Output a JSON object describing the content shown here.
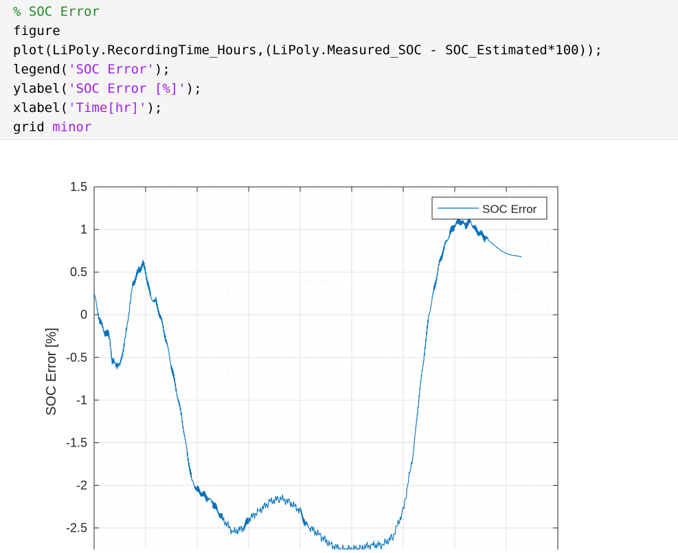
{
  "code": {
    "lines": [
      [
        {
          "t": "% SOC Error",
          "c": "comment"
        }
      ],
      [
        {
          "t": "figure",
          "c": "plain"
        }
      ],
      [
        {
          "t": "plot(LiPoly.RecordingTime_Hours,(LiPoly.Measured_SOC - SOC_Estimated*100));",
          "c": "plain"
        }
      ],
      [
        {
          "t": "legend(",
          "c": "plain"
        },
        {
          "t": "'SOC Error'",
          "c": "str"
        },
        {
          "t": ");",
          "c": "plain"
        }
      ],
      [
        {
          "t": "ylabel(",
          "c": "plain"
        },
        {
          "t": "'SOC Error [%]'",
          "c": "str"
        },
        {
          "t": ");",
          "c": "plain"
        }
      ],
      [
        {
          "t": "xlabel(",
          "c": "plain"
        },
        {
          "t": "'Time[hr]'",
          "c": "str"
        },
        {
          "t": ");",
          "c": "plain"
        }
      ],
      [
        {
          "t": "grid ",
          "c": "plain"
        },
        {
          "t": "minor",
          "c": "str"
        }
      ]
    ]
  },
  "colors": {
    "line": "#0072bd",
    "comment": "#228b22",
    "string": "#a020f0",
    "code_bg": "#f5f5f5",
    "major_grid": "#dcdcdc",
    "minor_grid": "#ececec"
  },
  "chart_data": {
    "type": "line",
    "title": "",
    "xlabel": "",
    "ylabel": "SOC Error [%]",
    "xlim": [
      0,
      9
    ],
    "ylim": [
      -2.85,
      1.5
    ],
    "y_ticks": [
      1.5,
      1,
      0.5,
      0,
      -0.5,
      -1,
      -1.5,
      -2,
      -2.5
    ],
    "y_tick_labels": [
      "1.5",
      "1",
      "0.5",
      "0",
      "-0.5",
      "-1",
      "-1.5",
      "-2",
      "-2.5"
    ],
    "x_ticks": [
      0,
      1,
      2,
      3,
      4,
      5,
      6,
      7,
      8,
      9
    ],
    "grid": "minor",
    "legend": {
      "entries": [
        "SOC Error"
      ],
      "location": "top-right"
    },
    "series": [
      {
        "name": "SOC Error",
        "x": [
          0.0,
          0.1,
          0.2,
          0.3,
          0.35,
          0.5,
          0.6,
          0.75,
          0.85,
          0.9,
          0.95,
          1.0,
          1.1,
          1.2,
          1.3,
          1.4,
          1.5,
          1.6,
          1.7,
          1.8,
          1.9,
          2.0,
          2.1,
          2.2,
          2.3,
          2.4,
          2.5,
          2.7,
          2.9,
          3.0,
          3.2,
          3.4,
          3.6,
          3.8,
          4.0,
          4.1,
          4.2,
          4.4,
          4.6,
          4.8,
          5.0,
          5.2,
          5.4,
          5.6,
          5.8,
          6.0,
          6.2,
          6.3,
          6.4,
          6.5,
          6.6,
          6.7,
          6.8,
          6.9,
          7.0,
          7.1,
          7.2,
          7.3,
          7.4,
          7.5,
          7.6,
          7.7,
          7.8,
          7.9,
          8.0,
          8.1,
          8.2,
          8.3
        ],
        "y": [
          0.25,
          -0.05,
          -0.2,
          -0.25,
          -0.55,
          -0.6,
          -0.3,
          0.35,
          0.5,
          0.55,
          0.6,
          0.5,
          0.2,
          0.15,
          -0.05,
          -0.3,
          -0.6,
          -0.9,
          -1.2,
          -1.6,
          -1.95,
          -2.05,
          -2.1,
          -2.15,
          -2.2,
          -2.3,
          -2.4,
          -2.55,
          -2.5,
          -2.4,
          -2.3,
          -2.2,
          -2.15,
          -2.2,
          -2.3,
          -2.45,
          -2.5,
          -2.6,
          -2.7,
          -2.75,
          -2.75,
          -2.73,
          -2.7,
          -2.7,
          -2.6,
          -2.3,
          -1.6,
          -1.0,
          -0.5,
          0.0,
          0.3,
          0.6,
          0.8,
          0.95,
          1.05,
          1.1,
          1.05,
          1.1,
          1.0,
          0.95,
          0.9,
          0.85,
          0.8,
          0.75,
          0.72,
          0.7,
          0.69,
          0.68
        ]
      }
    ]
  }
}
